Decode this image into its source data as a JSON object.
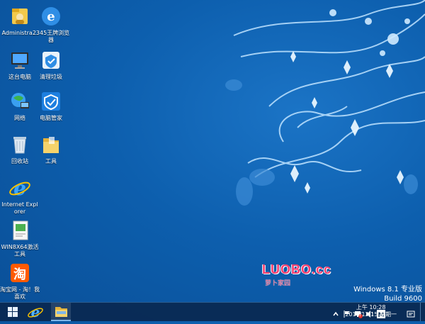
{
  "desktop_icons": [
    {
      "label": "Administra...",
      "icon": "user-folder-icon"
    },
    {
      "label": "2345王牌浏览器",
      "icon": "browser-2345-icon"
    },
    {
      "label": "这台电脑",
      "icon": "computer-icon"
    },
    {
      "label": "清理垃圾",
      "icon": "cleanup-icon"
    },
    {
      "label": "网络",
      "icon": "network-icon"
    },
    {
      "label": "电脑管家",
      "icon": "pc-manager-icon"
    },
    {
      "label": "回收站",
      "icon": "recycle-bin-icon"
    },
    {
      "label": "工具",
      "icon": "folder-icon"
    },
    {
      "label": "Internet Explorer",
      "icon": "internet-explorer-icon"
    },
    {
      "label": "WIN8X64激活工具",
      "icon": "activation-tool-icon"
    },
    {
      "label": "淘宝网 - 淘！我喜欢",
      "icon": "taobao-icon"
    }
  ],
  "watermark": {
    "logo": "LUOBO.cc",
    "sub": "萝卜家园"
  },
  "edition": {
    "line1": "Windows 8.1 专业版",
    "line2": "Build 9600"
  },
  "taskbar": {
    "time": "上午 10:28",
    "date": "2014/12/15 星期一"
  },
  "colors": {
    "desktop": "#0d5fae",
    "taskbar": "#0a2850",
    "accent": "#ff3d6e"
  }
}
